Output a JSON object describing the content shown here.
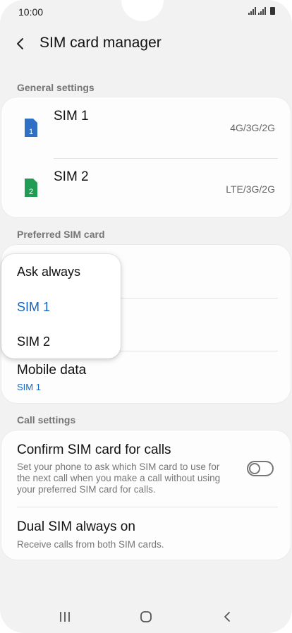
{
  "status_bar": {
    "time": "10:00",
    "icons": [
      "signal-sim1-icon",
      "signal-sim2-icon",
      "battery-icon"
    ]
  },
  "header": {
    "title": "SIM card manager",
    "back_icon": "back-arrow-icon"
  },
  "general_settings": {
    "label": "General settings",
    "sims": [
      {
        "name": "SIM 1",
        "network": "4G/3G/2G",
        "badge": "1",
        "color": "#2f6fc4"
      },
      {
        "name": "SIM 2",
        "network": "LTE/3G/2G",
        "badge": "2",
        "color": "#1f9d55"
      }
    ]
  },
  "preferred_sim": {
    "label": "Preferred SIM card",
    "mobile_data": {
      "title": "Mobile data",
      "value": "SIM 1"
    }
  },
  "dropdown": {
    "options": [
      "Ask always",
      "SIM 1",
      "SIM 2"
    ],
    "selected": "SIM 1"
  },
  "call_settings": {
    "label": "Call settings",
    "confirm": {
      "title": "Confirm SIM card for calls",
      "desc_lines": [
        "Set your phone to ask which SIM card to use for",
        "the next call when you make a call without using",
        "your preferred SIM card for calls."
      ],
      "toggle_on": false
    },
    "dual": {
      "title": "Dual SIM always on",
      "desc": "Receive calls from both SIM cards."
    }
  },
  "nav": {
    "icons": [
      "recent-apps-icon",
      "home-icon",
      "back-icon"
    ]
  },
  "colors": {
    "accent": "#1565c0",
    "background": "#f2f2f2",
    "card": "#fdfdfd"
  }
}
